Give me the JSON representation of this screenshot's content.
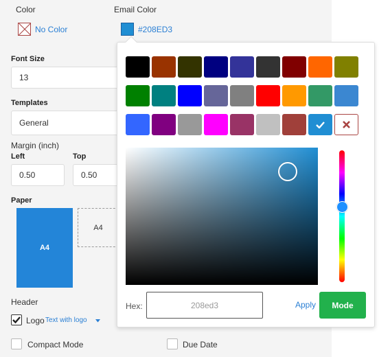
{
  "color_section": {
    "label": "Color",
    "no_color_label": "No Color"
  },
  "email_color": {
    "label": "Email Color",
    "value": "#208ED3",
    "swatch": "#208ed3"
  },
  "font_size": {
    "label": "Font Size",
    "value": "13"
  },
  "templates": {
    "label": "Templates",
    "value": "General"
  },
  "margin": {
    "label": "Margin (inch)",
    "left_label": "Left",
    "left_value": "0.50",
    "top_label": "Top",
    "top_value": "0.50"
  },
  "paper": {
    "label": "Paper",
    "selected": "A4",
    "option2": "A4"
  },
  "header": {
    "label": "Header",
    "logo_label": "Logo",
    "logo_checked": true,
    "logo_type": "Text with logo",
    "compact_mode_label": "Compact Mode",
    "due_date_label": "Due Date"
  },
  "picker": {
    "swatches": [
      [
        "#000000",
        "#993300",
        "#333300",
        "#000080",
        "#333399",
        "#333333",
        "#800000",
        "#ff6600",
        "#808000"
      ],
      [
        "#008000",
        "#008080",
        "#0000ff",
        "#666699",
        "#808080",
        "#ff0000",
        "#ff9900",
        "#339966",
        "#3b87d1"
      ],
      [
        "#3366ff",
        "#800080",
        "#999999",
        "#ff00ff",
        "#993366",
        "#c0c0c0",
        "#a0403a",
        "#208ed3",
        "clear"
      ]
    ],
    "selected_swatch": "#208ed3",
    "hex_label": "Hex:",
    "hex_value": "208ed3",
    "apply_label": "Apply",
    "mode_label": "Mode",
    "hue_position": 0.43
  }
}
